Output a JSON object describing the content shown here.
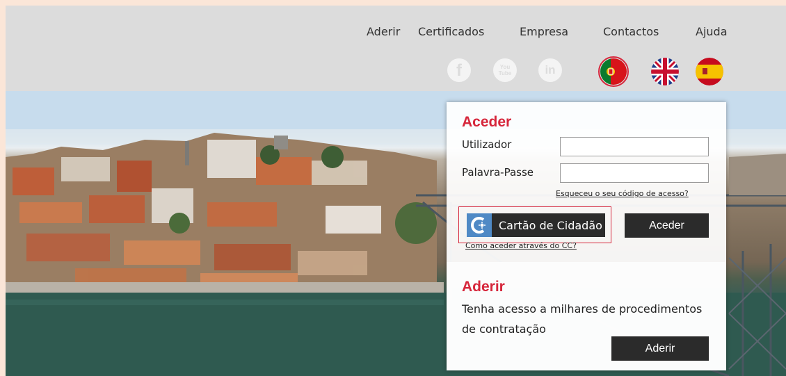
{
  "nav": {
    "items": [
      "Aderir",
      "Certificados",
      "Empresa",
      "Contactos",
      "Ajuda"
    ]
  },
  "social": {
    "icons": [
      "facebook-icon",
      "youtube-icon",
      "linkedin-icon"
    ],
    "facebook_glyph": "f",
    "youtube_glyph": "You Tube",
    "linkedin_glyph": "in"
  },
  "languages": [
    "portugal-flag-icon",
    "uk-flag-icon",
    "spain-flag-icon"
  ],
  "login": {
    "title": "Aceder",
    "username_label": "Utilizador",
    "username_value": "",
    "password_label": "Palavra-Passe",
    "password_value": "",
    "forgot_link": "Esqueceu o seu código de acesso?",
    "cc_button_label": "Cartão de Cidadão",
    "cc_help_link": "Como aceder através do CC?",
    "submit_label": "Aceder"
  },
  "signup": {
    "title": "Aderir",
    "description": "Tenha acesso a milhares de procedimentos de contratação",
    "button_label": "Aderir"
  },
  "colors": {
    "accent": "#d6263b",
    "header_bg": "#dcdcdc",
    "button_dark": "#2b2b2b",
    "cc_blue": "#4f89c5"
  }
}
